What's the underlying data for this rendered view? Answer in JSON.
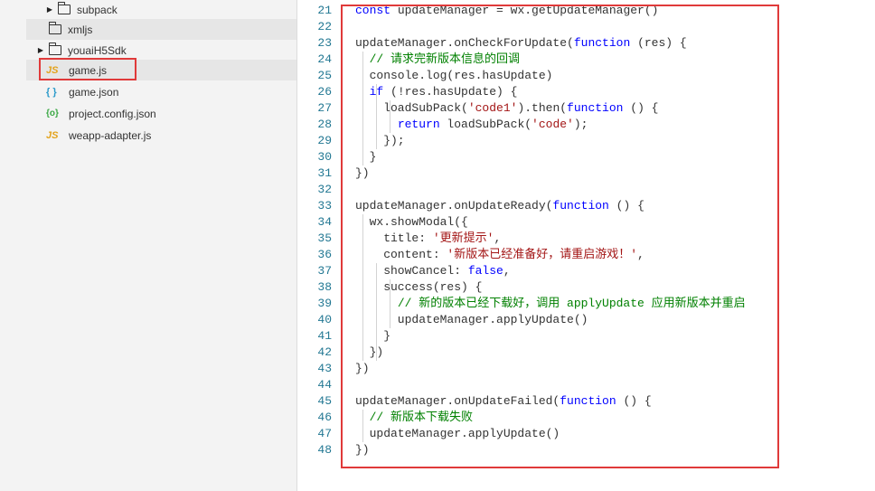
{
  "sidebar": {
    "items": [
      {
        "label": "subpack",
        "type": "folder"
      },
      {
        "label": "xmljs",
        "type": "folder"
      },
      {
        "label": "youaiH5Sdk",
        "type": "folder"
      },
      {
        "label": "game.js",
        "type": "js",
        "icon_text": "JS"
      },
      {
        "label": "game.json",
        "type": "json",
        "icon_text": "{ }"
      },
      {
        "label": "project.config.json",
        "type": "config",
        "icon_text": "{o}"
      },
      {
        "label": "weapp-adapter.js",
        "type": "js",
        "icon_text": "JS"
      }
    ]
  },
  "editor": {
    "lines": [
      {
        "n": "21",
        "code": "const updateManager = wx.getUpdateManager()"
      },
      {
        "n": "22",
        "code": ""
      },
      {
        "n": "23",
        "code": "updateManager.onCheckForUpdate(function (res) {"
      },
      {
        "n": "24",
        "code": "  // 请求完新版本信息的回调"
      },
      {
        "n": "25",
        "code": "  console.log(res.hasUpdate)"
      },
      {
        "n": "26",
        "code": "  if (!res.hasUpdate) {"
      },
      {
        "n": "27",
        "code": "    loadSubPack('code1').then(function () {"
      },
      {
        "n": "28",
        "code": "      return loadSubPack('code');"
      },
      {
        "n": "29",
        "code": "    });"
      },
      {
        "n": "30",
        "code": "  }"
      },
      {
        "n": "31",
        "code": "})"
      },
      {
        "n": "32",
        "code": ""
      },
      {
        "n": "33",
        "code": "updateManager.onUpdateReady(function () {"
      },
      {
        "n": "34",
        "code": "  wx.showModal({"
      },
      {
        "n": "35",
        "code": "    title: '更新提示',"
      },
      {
        "n": "36",
        "code": "    content: '新版本已经准备好，请重启游戏！',"
      },
      {
        "n": "37",
        "code": "    showCancel: false,"
      },
      {
        "n": "38",
        "code": "    success(res) {"
      },
      {
        "n": "39",
        "code": "      // 新的版本已经下载好，调用 applyUpdate 应用新版本并重启"
      },
      {
        "n": "40",
        "code": "      updateManager.applyUpdate()"
      },
      {
        "n": "41",
        "code": "    }"
      },
      {
        "n": "42",
        "code": "  })"
      },
      {
        "n": "43",
        "code": "})"
      },
      {
        "n": "44",
        "code": ""
      },
      {
        "n": "45",
        "code": "updateManager.onUpdateFailed(function () {"
      },
      {
        "n": "46",
        "code": "  // 新版本下载失败"
      },
      {
        "n": "47",
        "code": "  updateManager.applyUpdate()"
      },
      {
        "n": "48",
        "code": "})"
      }
    ]
  },
  "colors": {
    "highlight_box": "#e03a3a",
    "line_number": "#237893",
    "keyword": "#0000ff",
    "string": "#a31515",
    "comment": "#008000"
  }
}
